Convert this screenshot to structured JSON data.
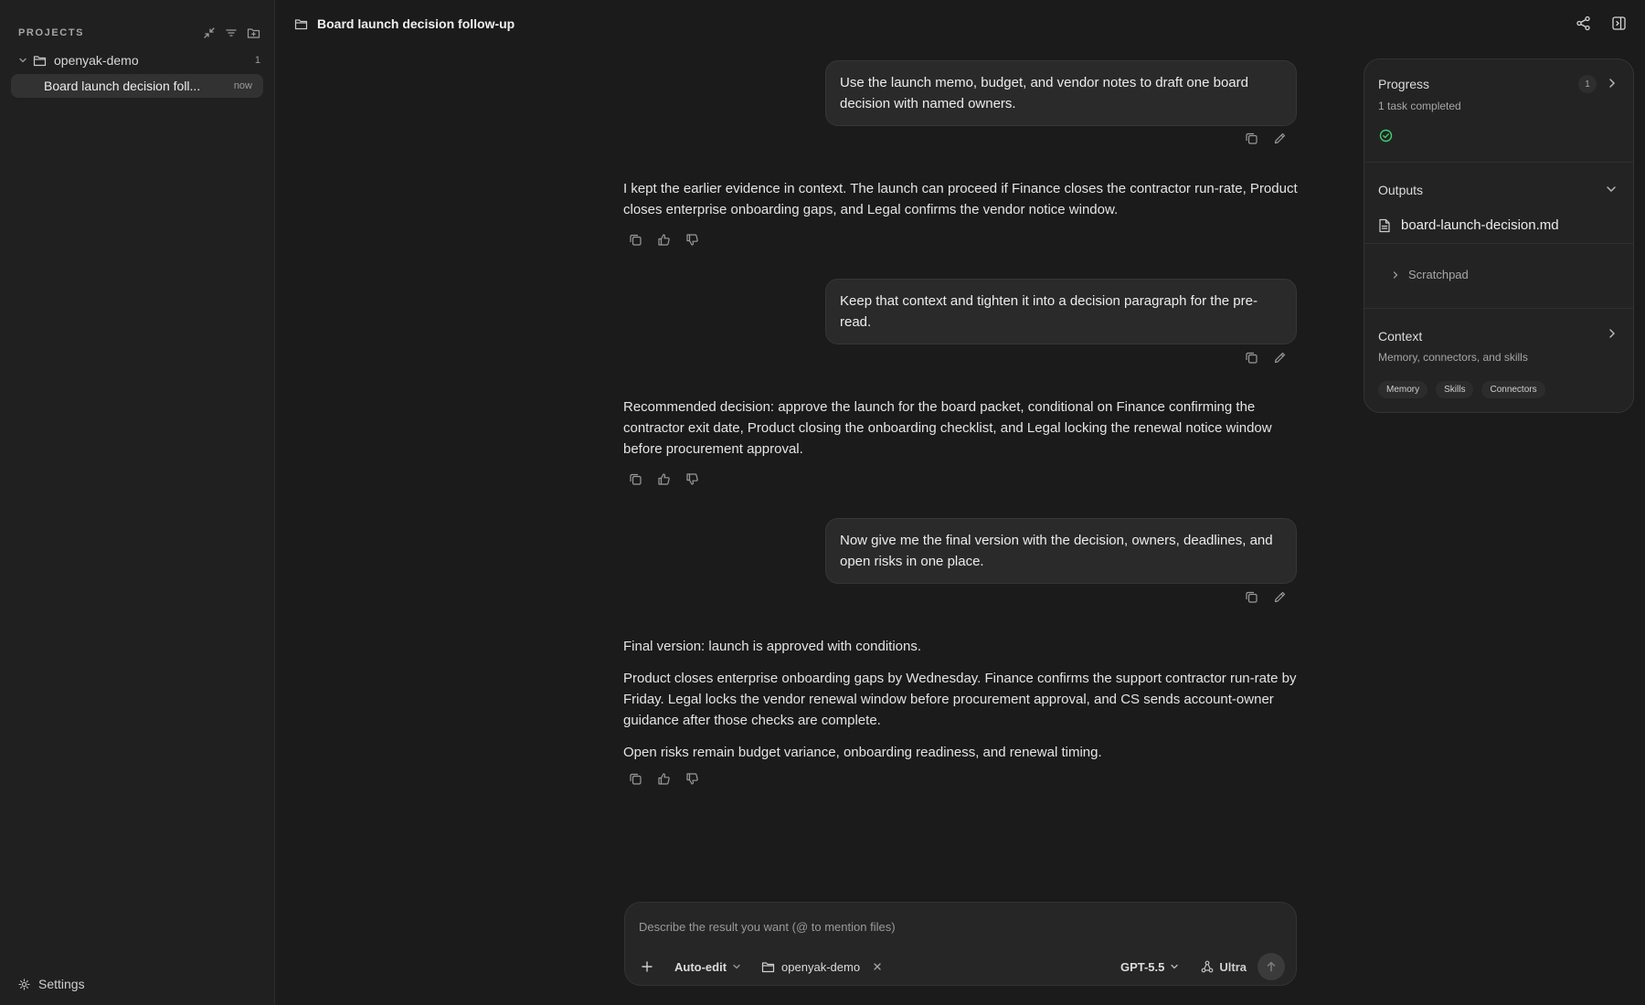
{
  "sidebar": {
    "title": "PROJECTS",
    "project": {
      "name": "openyak-demo",
      "count": "1"
    },
    "thread": {
      "title": "Board launch decision foll...",
      "time": "now"
    },
    "settings_label": "Settings"
  },
  "header": {
    "title": "Board launch decision follow-up"
  },
  "messages": {
    "u1": "Use the launch memo, budget, and vendor notes to draft one board decision with named owners.",
    "a1": "I kept the earlier evidence in context. The launch can proceed if Finance closes the contractor run-rate, Product closes enterprise onboarding gaps, and Legal confirms the vendor notice window.",
    "u2": "Keep that context and tighten it into a decision paragraph for the pre-read.",
    "a2": "Recommended decision: approve the launch for the board packet, conditional on Finance confirming the contractor exit date, Product closing the onboarding checklist, and Legal locking the renewal notice window before procurement approval.",
    "u3": "Now give me the final version with the decision, owners, deadlines, and open risks in one place.",
    "a3_p1": "Final version: launch is approved with conditions.",
    "a3_p2": "Product closes enterprise onboarding gaps by Wednesday. Finance confirms the support contractor run-rate by Friday. Legal locks the vendor renewal window before procurement approval, and CS sends account-owner guidance after those checks are complete.",
    "a3_p3": "Open risks remain budget variance, onboarding readiness, and renewal timing."
  },
  "composer": {
    "placeholder": "Describe the result you want (@ to mention files)",
    "value": "",
    "mode": "Auto-edit",
    "project": "openyak-demo",
    "model": "GPT-5.5",
    "effort": "Ultra"
  },
  "panel": {
    "progress": {
      "title": "Progress",
      "badge": "1",
      "subtitle": "1 task completed"
    },
    "outputs": {
      "title": "Outputs",
      "file": "board-launch-decision.md",
      "scratchpad": "Scratchpad"
    },
    "context": {
      "title": "Context",
      "subtitle": "Memory, connectors, and skills",
      "chips": [
        "Memory",
        "Skills",
        "Connectors"
      ]
    }
  },
  "colors": {
    "background": "#1b1b1b",
    "sidebar": "#202020",
    "bubble": "#2a2a2a",
    "success": "#3ecf6e"
  },
  "icons": [
    "collapse-icon",
    "filter-icon",
    "new-folder-icon",
    "folder-icon",
    "chevron-down-icon",
    "gear-icon",
    "share-icon",
    "panel-toggle-icon",
    "copy-icon",
    "edit-icon",
    "thumbs-up-icon",
    "thumbs-down-icon",
    "plus-icon",
    "close-icon",
    "agent-icon",
    "arrow-up-icon",
    "check-circle-icon",
    "file-icon",
    "chevron-right-icon"
  ]
}
